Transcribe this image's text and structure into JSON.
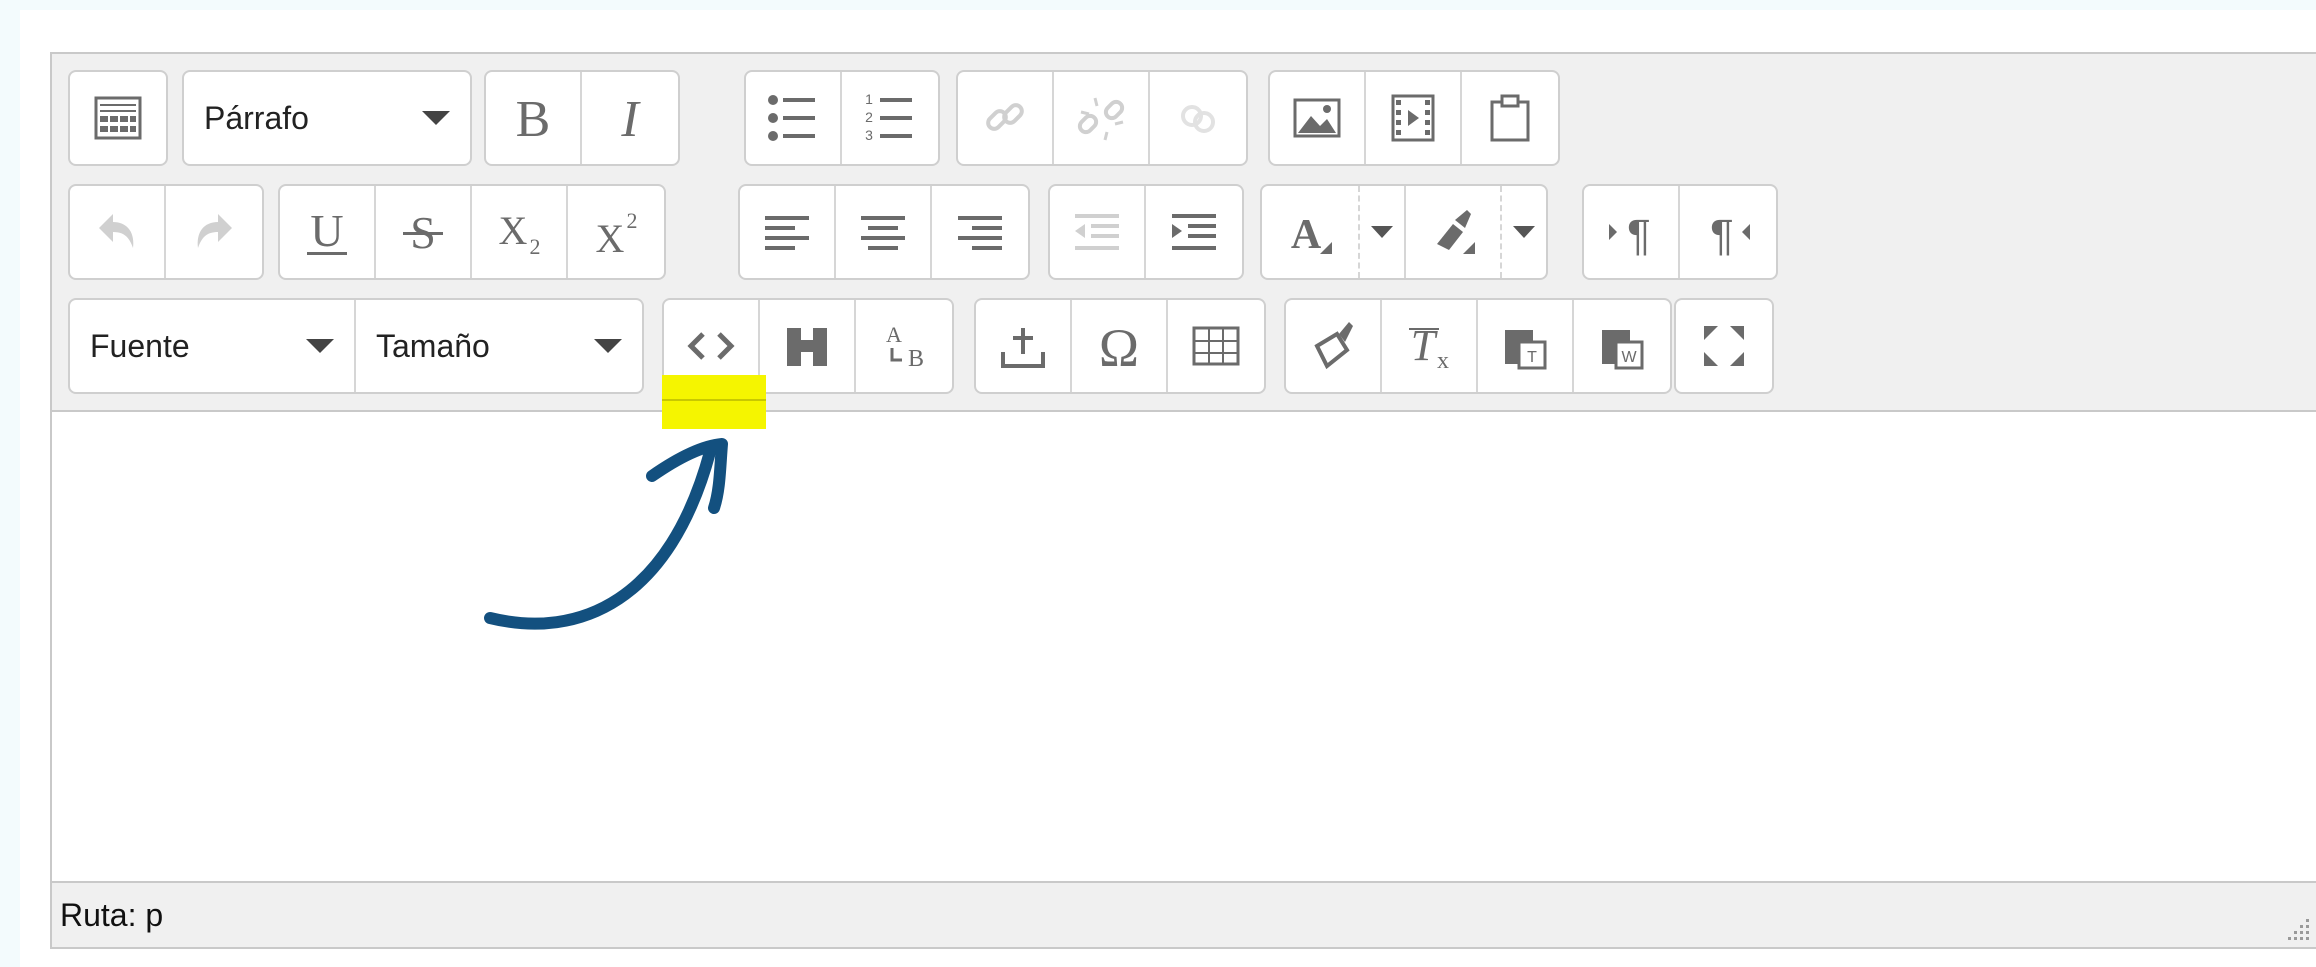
{
  "editor": {
    "format_combo": {
      "value": "Párrafo"
    },
    "font_combo": {
      "value": "Fuente"
    },
    "size_combo": {
      "value": "Tamaño"
    },
    "toolbar_icons": [
      "show-more-icon",
      "bold-icon",
      "italic-icon",
      "bulleted-list-icon",
      "numbered-list-icon",
      "link-icon",
      "unlink-icon",
      "anchor-icon",
      "image-icon",
      "media-icon",
      "paste-icon",
      "undo-icon",
      "redo-icon",
      "underline-icon",
      "strikethrough-icon",
      "subscript-icon",
      "superscript-icon",
      "align-left-icon",
      "align-center-icon",
      "align-right-icon",
      "outdent-icon",
      "indent-icon",
      "text-color-icon",
      "background-color-icon",
      "ltr-icon",
      "rtl-icon",
      "source-code-icon",
      "find-icon",
      "replace-icon",
      "upload-icon",
      "special-char-icon",
      "table-icon",
      "cleanup-icon",
      "clear-format-icon",
      "paste-text-icon",
      "paste-word-icon",
      "fullscreen-icon"
    ],
    "statusbar": {
      "path_text": "Ruta: p"
    }
  },
  "annotation": {
    "highlight_color": "#f5f500",
    "arrow_color": "#13507f"
  },
  "colors": {
    "toolbar_bg": "#f0f0f0",
    "border": "#c9c9c9",
    "icon": "#6b6b6b",
    "icon_disabled": "#d0d0d0",
    "page_bg": "#f3fbfd"
  }
}
